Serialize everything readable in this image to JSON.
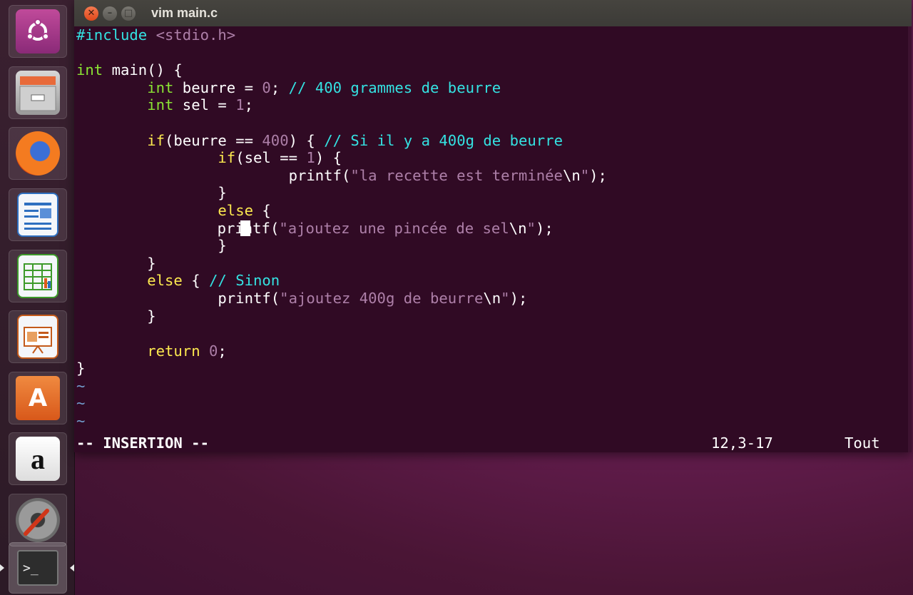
{
  "window": {
    "title": "vim main.c",
    "background": "#300a24"
  },
  "launcher": {
    "items": [
      {
        "name": "ubuntu-dash",
        "icon": "ubuntu-logo-icon"
      },
      {
        "name": "files",
        "icon": "files-cabinet-icon"
      },
      {
        "name": "firefox",
        "icon": "firefox-icon"
      },
      {
        "name": "libreoffice-writer",
        "icon": "writer-icon"
      },
      {
        "name": "libreoffice-calc",
        "icon": "calc-icon"
      },
      {
        "name": "libreoffice-impress",
        "icon": "impress-icon"
      },
      {
        "name": "ubuntu-software",
        "icon": "store-bag-icon",
        "glyph": "A"
      },
      {
        "name": "amazon",
        "icon": "amazon-icon",
        "glyph": "a"
      },
      {
        "name": "system-settings",
        "icon": "settings-gear-icon"
      },
      {
        "name": "terminal",
        "icon": "terminal-icon",
        "glyph": ">_",
        "active": true
      }
    ]
  },
  "editor": {
    "lines": [
      {
        "t0": "#include ",
        "t1": "<stdio.h>"
      },
      {
        "t0": ""
      },
      {
        "t0": "int",
        "t1": " main() {"
      },
      {
        "t0": "        ",
        "t1": "int",
        "t2": " beurre = ",
        "t3": "0",
        "t4": "; ",
        "t5": "// 400 grammes de beurre"
      },
      {
        "t0": "        ",
        "t1": "int",
        "t2": " sel = ",
        "t3": "1",
        "t4": ";"
      },
      {
        "t0": ""
      },
      {
        "t0": "        ",
        "t1": "if",
        "t2": "(beurre == ",
        "t3": "400",
        "t4": ") { ",
        "t5": "// Si il y a 400g de beurre"
      },
      {
        "t0": "                ",
        "t1": "if",
        "t2": "(sel == ",
        "t3": "1",
        "t4": ") {"
      },
      {
        "t0": "                        printf(",
        "t1": "\"la recette est terminée",
        "t2": "\\n",
        "t3": "\"",
        "t4": ");"
      },
      {
        "t0": "                }"
      },
      {
        "t0": "                ",
        "t1": "else",
        "t2": " {"
      },
      {
        "t0": "                        printf(",
        "t1": "\"ajoutez une pincée de sel",
        "t2": "\\n",
        "t3": "\"",
        "t4": ");"
      },
      {
        "t0": "                }"
      },
      {
        "t0": "        }"
      },
      {
        "t0": "        ",
        "t1": "else",
        "t2": " { ",
        "t3": "// Sinon"
      },
      {
        "t0": "                printf(",
        "t1": "\"ajoutez 400g de beurre",
        "t2": "\\n",
        "t3": "\"",
        "t4": ");"
      },
      {
        "t0": "        }"
      },
      {
        "t0": ""
      },
      {
        "t0": "        ",
        "t1": "return",
        "t2": " ",
        "t3": "0",
        "t4": ";"
      },
      {
        "t0": "}"
      }
    ],
    "tildes": [
      "~",
      "~",
      "~"
    ],
    "cursor_line": 12,
    "status": {
      "mode": "-- INSERTION --",
      "position": "12,3-17",
      "scroll": "Tout"
    }
  }
}
